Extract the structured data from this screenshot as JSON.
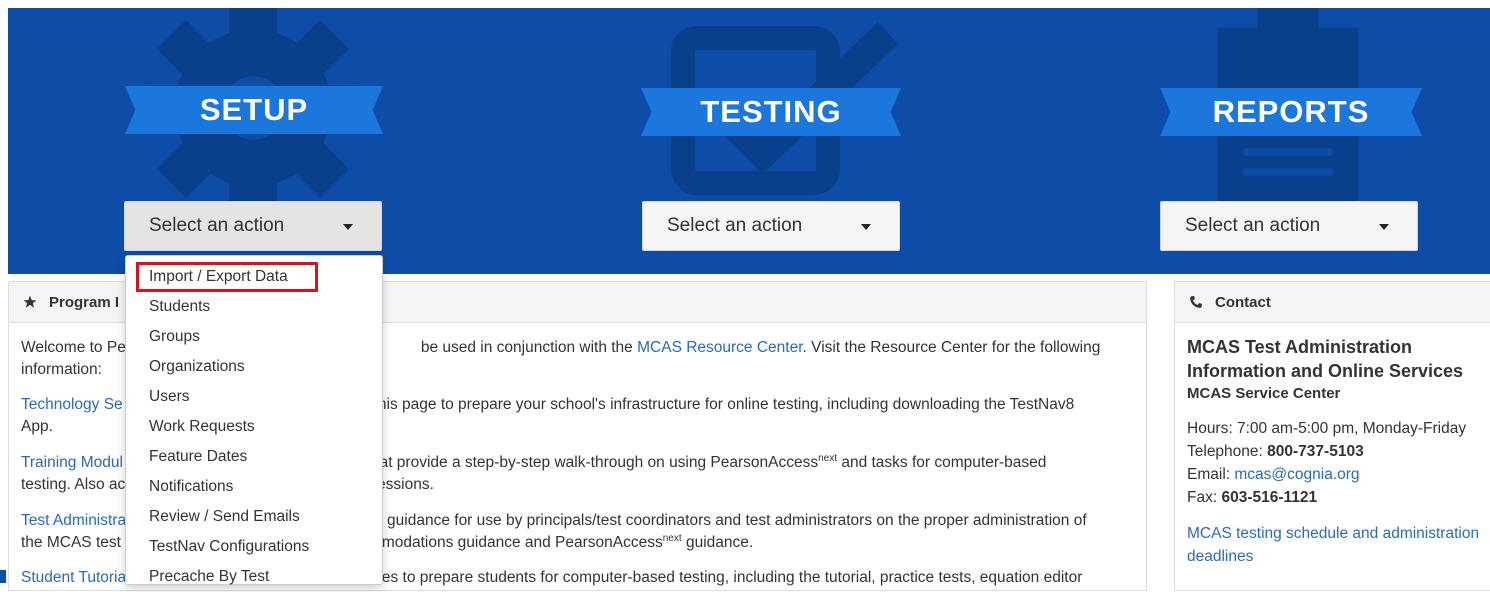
{
  "setup": {
    "title": "SETUP",
    "select_label": "Select an action",
    "icon": "gear-icon"
  },
  "testing": {
    "title": "TESTING",
    "select_label": "Select an action",
    "icon": "checkbox-icon"
  },
  "reports": {
    "title": "REPORTS",
    "select_label": "Select an action",
    "icon": "clipboard-icon"
  },
  "dropdown": {
    "items": [
      "Import / Export Data",
      "Students",
      "Groups",
      "Organizations",
      "Users",
      "Work Requests",
      "Feature Dates",
      "Notifications",
      "Review / Send Emails",
      "TestNav Configurations",
      "Precache By Test"
    ]
  },
  "program": {
    "header": "Program I",
    "icon": "star-icon",
    "p1_a": "Welcome to Pe",
    "p1_b": "be used in conjunction with the",
    "p1_link": "MCAS Resource Center",
    "p1_c": ". Visit the Resource Center for the following",
    "p1_d": "information:",
    "p2_link": "Technology Se",
    "p2_a": "n this page to prepare your school's infrastructure for online testing, including downloading the TestNav8",
    "p2_b": "App.",
    "p3_link": "Training Modul",
    "p3_a": "hat provide a step-by-step walk-through on using PearsonAccess",
    "p3_sup": "next",
    "p3_b": " and tasks for computer-based",
    "p3_c": "testing. Also ac",
    "p3_d": "sessions.",
    "p4_link": "Test Administra",
    "p4_a": "d guidance for use by principals/test coordinators and test administrators on the proper administration of",
    "p4_b": "the MCAS test",
    "p4_c": "mmodations guidance and PearsonAccess",
    "p4_sup": "next",
    "p4_d": " guidance.",
    "p5_link": "Student Tutoria",
    "p5_a": "ces to prepare students for computer-based testing, including the tutorial, practice tests, equation editor"
  },
  "contact": {
    "header": "Contact",
    "icon": "phone-icon",
    "title_line1": "MCAS Test Administration",
    "title_line2": "Information and Online Services",
    "subtitle": "MCAS Service Center",
    "hours": "Hours: 7:00 am-5:00 pm, Monday-Friday",
    "tel_label": "Telephone: ",
    "tel_value": "800-737-5103",
    "email_label": "Email: ",
    "email_value": "mcas@cognia.org",
    "fax_label": "Fax: ",
    "fax_value": "603-516-1121",
    "link_line1": "MCAS testing schedule and administration",
    "link_line2": "deadlines"
  },
  "colors": {
    "hero_bg": "#0d4da8",
    "ribbon": "#1b77db",
    "highlight": "#d9121e",
    "link": "#2a6ab8"
  }
}
